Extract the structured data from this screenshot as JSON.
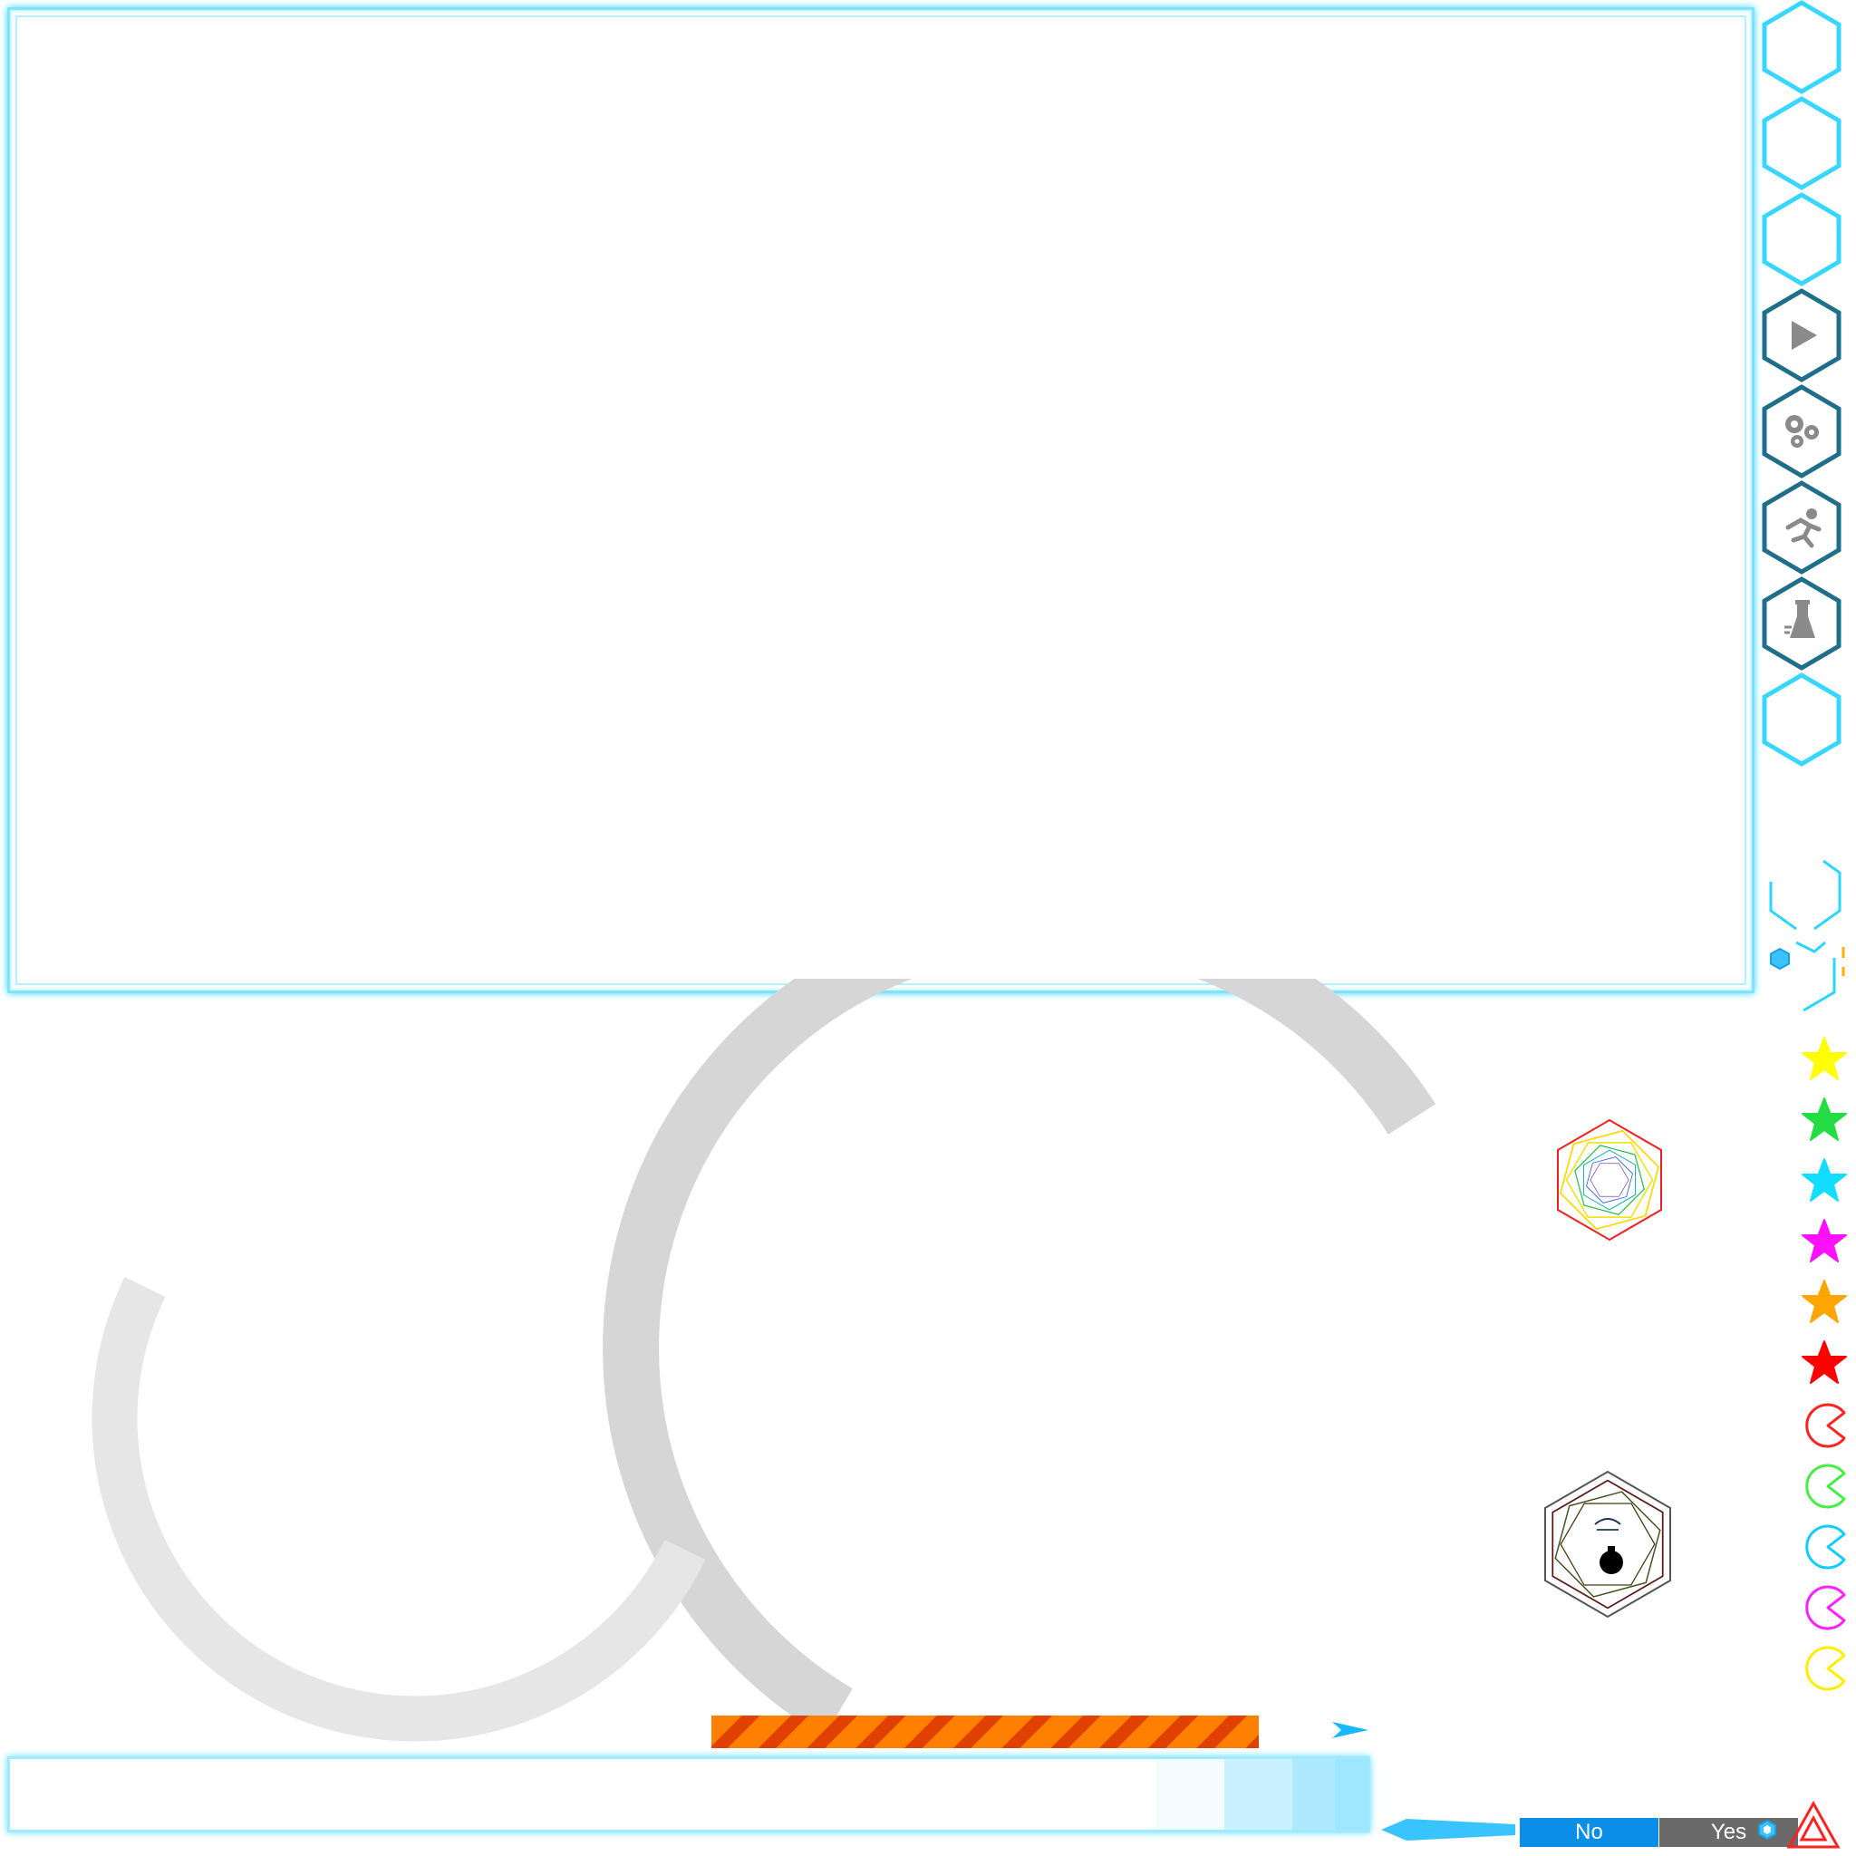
{
  "dialog": {
    "no_label": "No",
    "yes_label": "Yes"
  },
  "menu": {
    "items": [
      {
        "name": "empty-slot-1",
        "icon": "none"
      },
      {
        "name": "empty-slot-2",
        "icon": "none"
      },
      {
        "name": "empty-slot-3",
        "icon": "none"
      },
      {
        "name": "play",
        "icon": "play-icon"
      },
      {
        "name": "settings",
        "icon": "gears-icon"
      },
      {
        "name": "run",
        "icon": "runner-icon"
      },
      {
        "name": "lab",
        "icon": "flask-icon"
      },
      {
        "name": "empty-slot-4",
        "icon": "none"
      }
    ]
  },
  "stars": [
    "#ffff00",
    "#22dd44",
    "#11ddff",
    "#ff11ff",
    "#ffa500",
    "#ff0000"
  ],
  "pacs": [
    "#ff2222",
    "#44ee44",
    "#11ccff",
    "#ff22ff",
    "#ffee00"
  ],
  "colors": {
    "accent": "#39d6ff",
    "menu_dark": "#1f6f8b",
    "ring": "#d6d6d6",
    "hazard_orange": "#ff7f00",
    "hazard_red": "#e04000"
  },
  "progress": {
    "input_bar_fill_fraction": 0.76
  }
}
